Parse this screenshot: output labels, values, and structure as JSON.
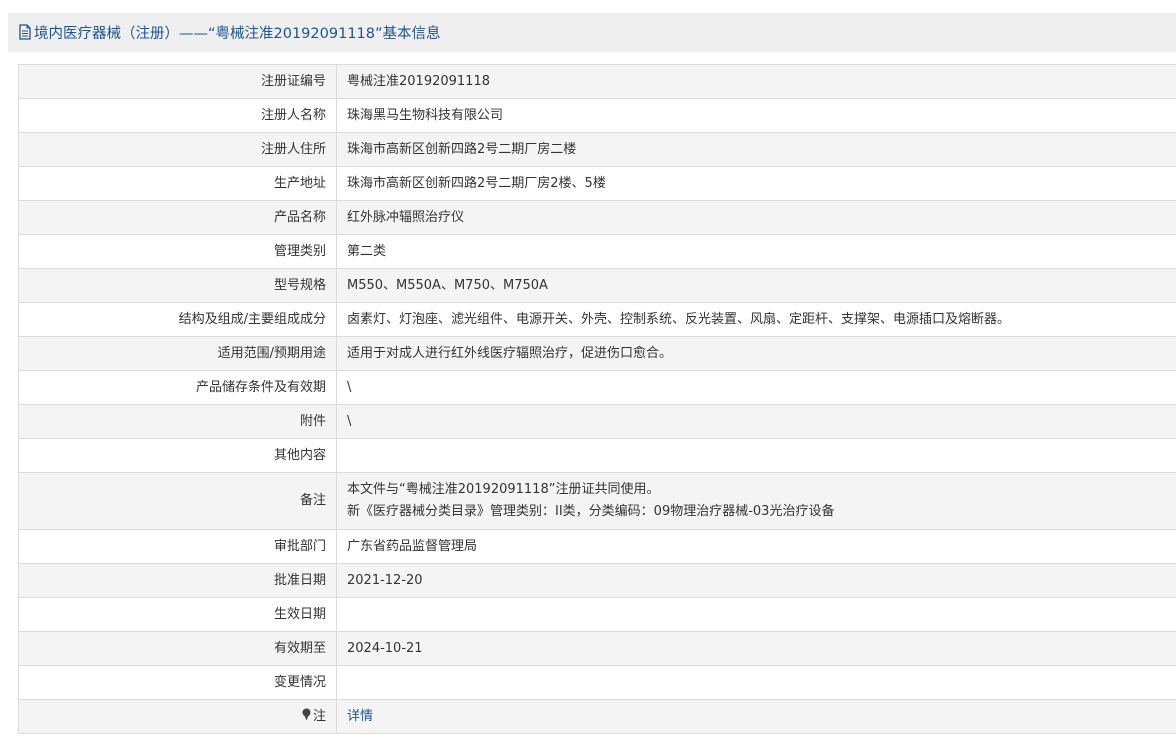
{
  "header": {
    "title": "境内医疗器械（注册）——“粤械注准20192091118”基本信息",
    "icon": "document-icon"
  },
  "rows": [
    {
      "label": "注册证编号",
      "value": "粤械注准20192091118"
    },
    {
      "label": "注册人名称",
      "value": "珠海黑马生物科技有限公司"
    },
    {
      "label": "注册人住所",
      "value": "珠海市高新区创新四路2号二期厂房二楼"
    },
    {
      "label": "生产地址",
      "value": "珠海市高新区创新四路2号二期厂房2楼、5楼"
    },
    {
      "label": "产品名称",
      "value": "红外脉冲辐照治疗仪"
    },
    {
      "label": "管理类别",
      "value": "第二类"
    },
    {
      "label": "型号规格",
      "value": "M550、M550A、M750、M750A"
    },
    {
      "label": "结构及组成/主要组成成分",
      "value": "卤素灯、灯泡座、滤光组件、电源开关、外壳、控制系统、反光装置、风扇、定距杆、支撑架、电源插口及熔断器。"
    },
    {
      "label": "适用范围/预期用途",
      "value": "适用于对成人进行红外线医疗辐照治疗，促进伤口愈合。"
    },
    {
      "label": "产品储存条件及有效期",
      "value": "\\"
    },
    {
      "label": "附件",
      "value": "\\"
    },
    {
      "label": "其他内容",
      "value": ""
    },
    {
      "label": "备注",
      "value_line1": "本文件与“粤械注准20192091118”注册证共同使用。",
      "value_line2": "新《医疗器械分类目录》管理类别：II类，分类编码：09物理治疗器械-03光治疗设备"
    },
    {
      "label": "审批部门",
      "value": "广东省药品监督管理局"
    },
    {
      "label": "批准日期",
      "value": "2021-12-20"
    },
    {
      "label": "生效日期",
      "value": ""
    },
    {
      "label": "有效期至",
      "value": "2024-10-21"
    },
    {
      "label": "变更情况",
      "value": ""
    },
    {
      "label": "注",
      "icon": "pin-icon",
      "value": "详情"
    }
  ],
  "colors": {
    "title_blue": "#1e5494",
    "link_blue": "#1e5494",
    "stripe_gray": "#f4f4f4",
    "border": "#dcdcdc"
  }
}
